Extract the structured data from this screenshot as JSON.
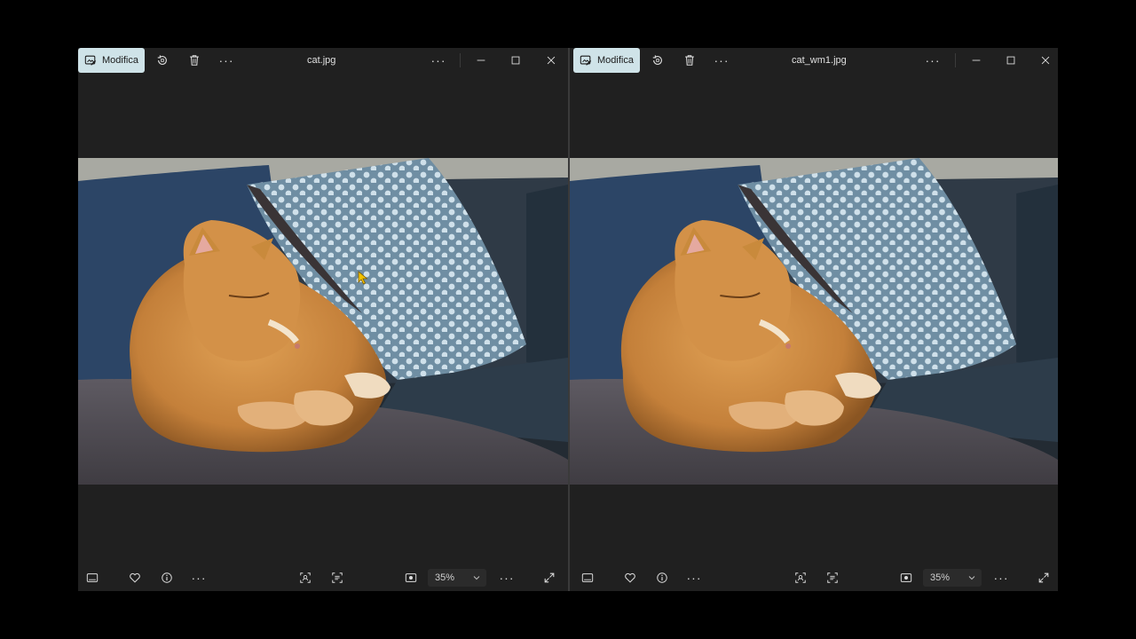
{
  "windows": [
    {
      "edit_label": "Modifica",
      "filename": "cat.jpg",
      "zoom": "35%",
      "icons": {
        "edit": "edit-photo-icon",
        "rotate": "rotate-icon",
        "delete": "trash-icon",
        "more": "more-icon",
        "minimize": "minimize-icon",
        "maximize": "maximize-icon",
        "close": "close-icon",
        "filmstrip": "filmstrip-icon",
        "favorite": "heart-icon",
        "info": "info-icon",
        "face": "face-scan-icon",
        "text": "text-scan-icon",
        "fit": "fit-view-icon",
        "fullscreen": "fullscreen-icon"
      }
    },
    {
      "edit_label": "Modifica",
      "filename": "cat_wm1.jpg",
      "zoom": "35%",
      "icons": {
        "edit": "edit-photo-icon",
        "rotate": "rotate-icon",
        "delete": "trash-icon",
        "more": "more-icon",
        "minimize": "minimize-icon",
        "maximize": "maximize-icon",
        "close": "close-icon",
        "filmstrip": "filmstrip-icon",
        "favorite": "heart-icon",
        "info": "info-icon",
        "face": "face-scan-icon",
        "text": "text-scan-icon",
        "fit": "fit-view-icon",
        "fullscreen": "fullscreen-icon"
      }
    }
  ],
  "colors": {
    "accent_button": "#cfe3e8",
    "window_bg": "#202020",
    "cat": "#c98a3c",
    "pillow": "#a9c3d3",
    "sofa": "#2e3b48"
  }
}
